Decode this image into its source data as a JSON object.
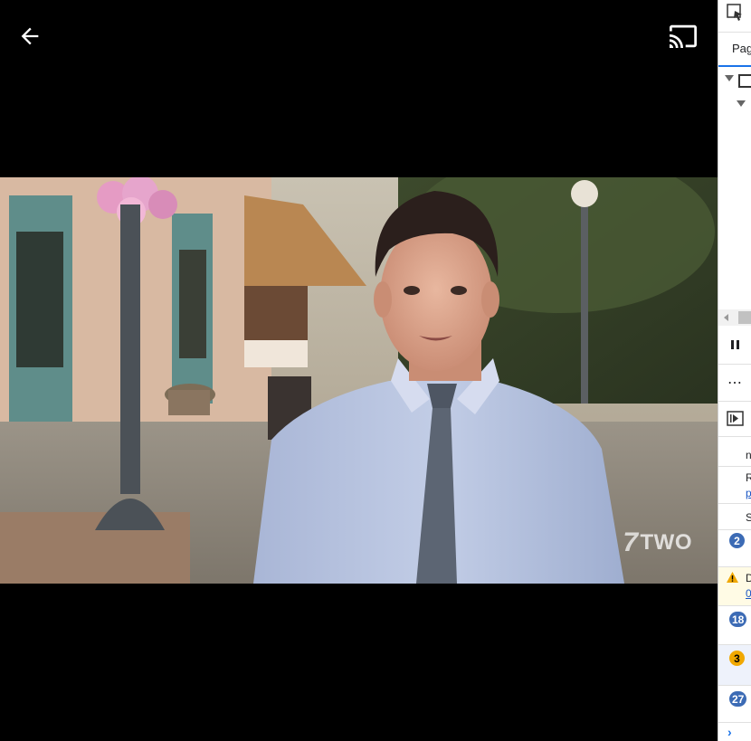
{
  "player": {
    "back_icon": "arrow-left-icon",
    "cast_icon": "cast-icon",
    "watermark": {
      "seven": "7",
      "channel": "TWO"
    },
    "colors": {
      "background": "#000000",
      "icon": "#ffffff"
    }
  },
  "devtools": {
    "tab_label": "Pag",
    "row_text": [
      "n",
      "R",
      "p",
      "S",
      "D",
      "0"
    ],
    "badges": [
      "2",
      "3",
      "18",
      "27"
    ],
    "icons": [
      "inspect-icon",
      "pause-icon",
      "more-icon",
      "step-icon",
      "chevron-right-icon",
      "warning-icon"
    ],
    "accent": "#3c6bb5",
    "warn_color": "#f1a800"
  }
}
